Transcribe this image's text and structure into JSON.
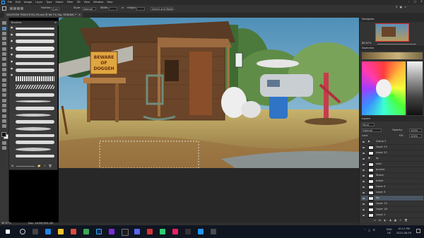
{
  "menubar": {
    "items": [
      "File",
      "Edit",
      "Image",
      "Layer",
      "Type",
      "Select",
      "Filter",
      "3D",
      "View",
      "Window",
      "Help"
    ]
  },
  "options": {
    "feather_label": "Feather:",
    "feather_value": "0 px",
    "style_label": "Style:",
    "style_value": "Normal",
    "width_label": "Width:",
    "height_label": "Height:",
    "select_mask": "Select and Mask..."
  },
  "document": {
    "tab_title": "VACATION TRAILER BG-05.psd @ 66.7% (bg, RGB/8#) *",
    "zoom": "66.67%",
    "doc_size": "Doc: 18.9M/393.2M"
  },
  "brushes_panel": {
    "title": "Brushes"
  },
  "artwork": {
    "sign_text_1": "BEWARE",
    "sign_text_2": "OF",
    "sign_text_3": "DOGGEH"
  },
  "navigator": {
    "title": "Navigator",
    "zoom": "66.67%"
  },
  "swatches": {
    "title": "Swatches"
  },
  "layers": {
    "title": "Layers",
    "kind": "Kind",
    "blend": "Normal",
    "opacity_label": "Opacity:",
    "opacity_value": "100%",
    "lock_label": "Lock:",
    "fill_label": "Fill:",
    "fill_value": "100%",
    "items": [
      {
        "name": "Group 2"
      },
      {
        "name": "Layer 23"
      },
      {
        "name": "Layer 22"
      },
      {
        "name": "fg"
      },
      {
        "name": "char"
      },
      {
        "name": "bucket"
      },
      {
        "name": "Shack"
      },
      {
        "name": "trailer"
      },
      {
        "name": "Layer 4"
      },
      {
        "name": "Layer 3"
      },
      {
        "name": "bg"
      },
      {
        "name": "Layer 19"
      },
      {
        "name": "Layer 18"
      },
      {
        "name": "Layer 1"
      }
    ]
  },
  "taskbar": {
    "lang": "ENG",
    "region": "US",
    "time": "10:11 PM",
    "date": "2021-06-29"
  }
}
